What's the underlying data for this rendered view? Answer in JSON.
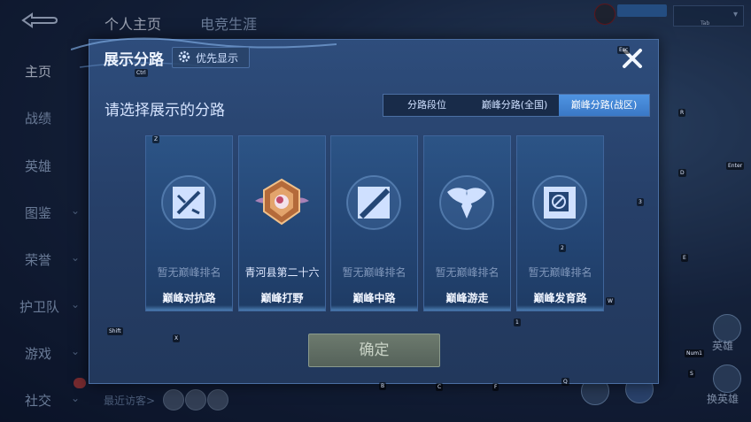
{
  "top_bar": {
    "tabs": [
      {
        "label": "个人主页",
        "active": true
      },
      {
        "label": "电竞生涯",
        "active": false
      }
    ],
    "right_tag": "Tab"
  },
  "side_nav": {
    "items": [
      {
        "label": "主页",
        "active": true,
        "has_chevron": false
      },
      {
        "label": "战绩",
        "active": false,
        "has_chevron": false
      },
      {
        "label": "英雄",
        "active": false,
        "has_chevron": false
      },
      {
        "label": "图鉴",
        "active": false,
        "has_chevron": true
      },
      {
        "label": "荣誉",
        "active": false,
        "has_chevron": true
      },
      {
        "label": "护卫队",
        "active": false,
        "has_chevron": true
      },
      {
        "label": "游戏",
        "active": false,
        "has_chevron": true
      },
      {
        "label": "社交",
        "active": false,
        "has_chevron": true
      }
    ]
  },
  "bottom": {
    "recent_visitors": "最近访客>",
    "right_labels": [
      "英雄",
      "换英雄"
    ]
  },
  "key_hints": [
    "Ctrl",
    "Esc",
    "Z",
    "R",
    "D",
    "3",
    "Enter",
    "E",
    "2",
    "W",
    "1",
    "X",
    "Shift",
    "B",
    "C",
    "F",
    "Q",
    "Num1",
    "S"
  ],
  "modal": {
    "title": "展示分路",
    "priority_label": "优先显示",
    "subtitle": "请选择展示的分路",
    "tabs": [
      {
        "label": "分路段位",
        "active": false
      },
      {
        "label": "巅峰分路(全国)",
        "active": false
      },
      {
        "label": "巅峰分路(战区)",
        "active": true
      }
    ],
    "cards": [
      {
        "rank": "暂无巅峰排名",
        "route": "巅峰对抗路",
        "icon": "clash-lane-icon",
        "has_rank": false
      },
      {
        "rank": "青河县第二十六",
        "route": "巅峰打野",
        "icon": "jungle-badge-icon",
        "has_rank": true
      },
      {
        "rank": "暂无巅峰排名",
        "route": "巅峰中路",
        "icon": "mid-lane-icon",
        "has_rank": false
      },
      {
        "rank": "暂无巅峰排名",
        "route": "巅峰游走",
        "icon": "roam-icon",
        "has_rank": false
      },
      {
        "rank": "暂无巅峰排名",
        "route": "巅峰发育路",
        "icon": "farm-lane-icon",
        "has_rank": false
      }
    ],
    "confirm_label": "确定"
  },
  "colors": {
    "accent": "#3a78c6",
    "card_bg": "#244675",
    "confirm_bg": "#5f6c62"
  }
}
